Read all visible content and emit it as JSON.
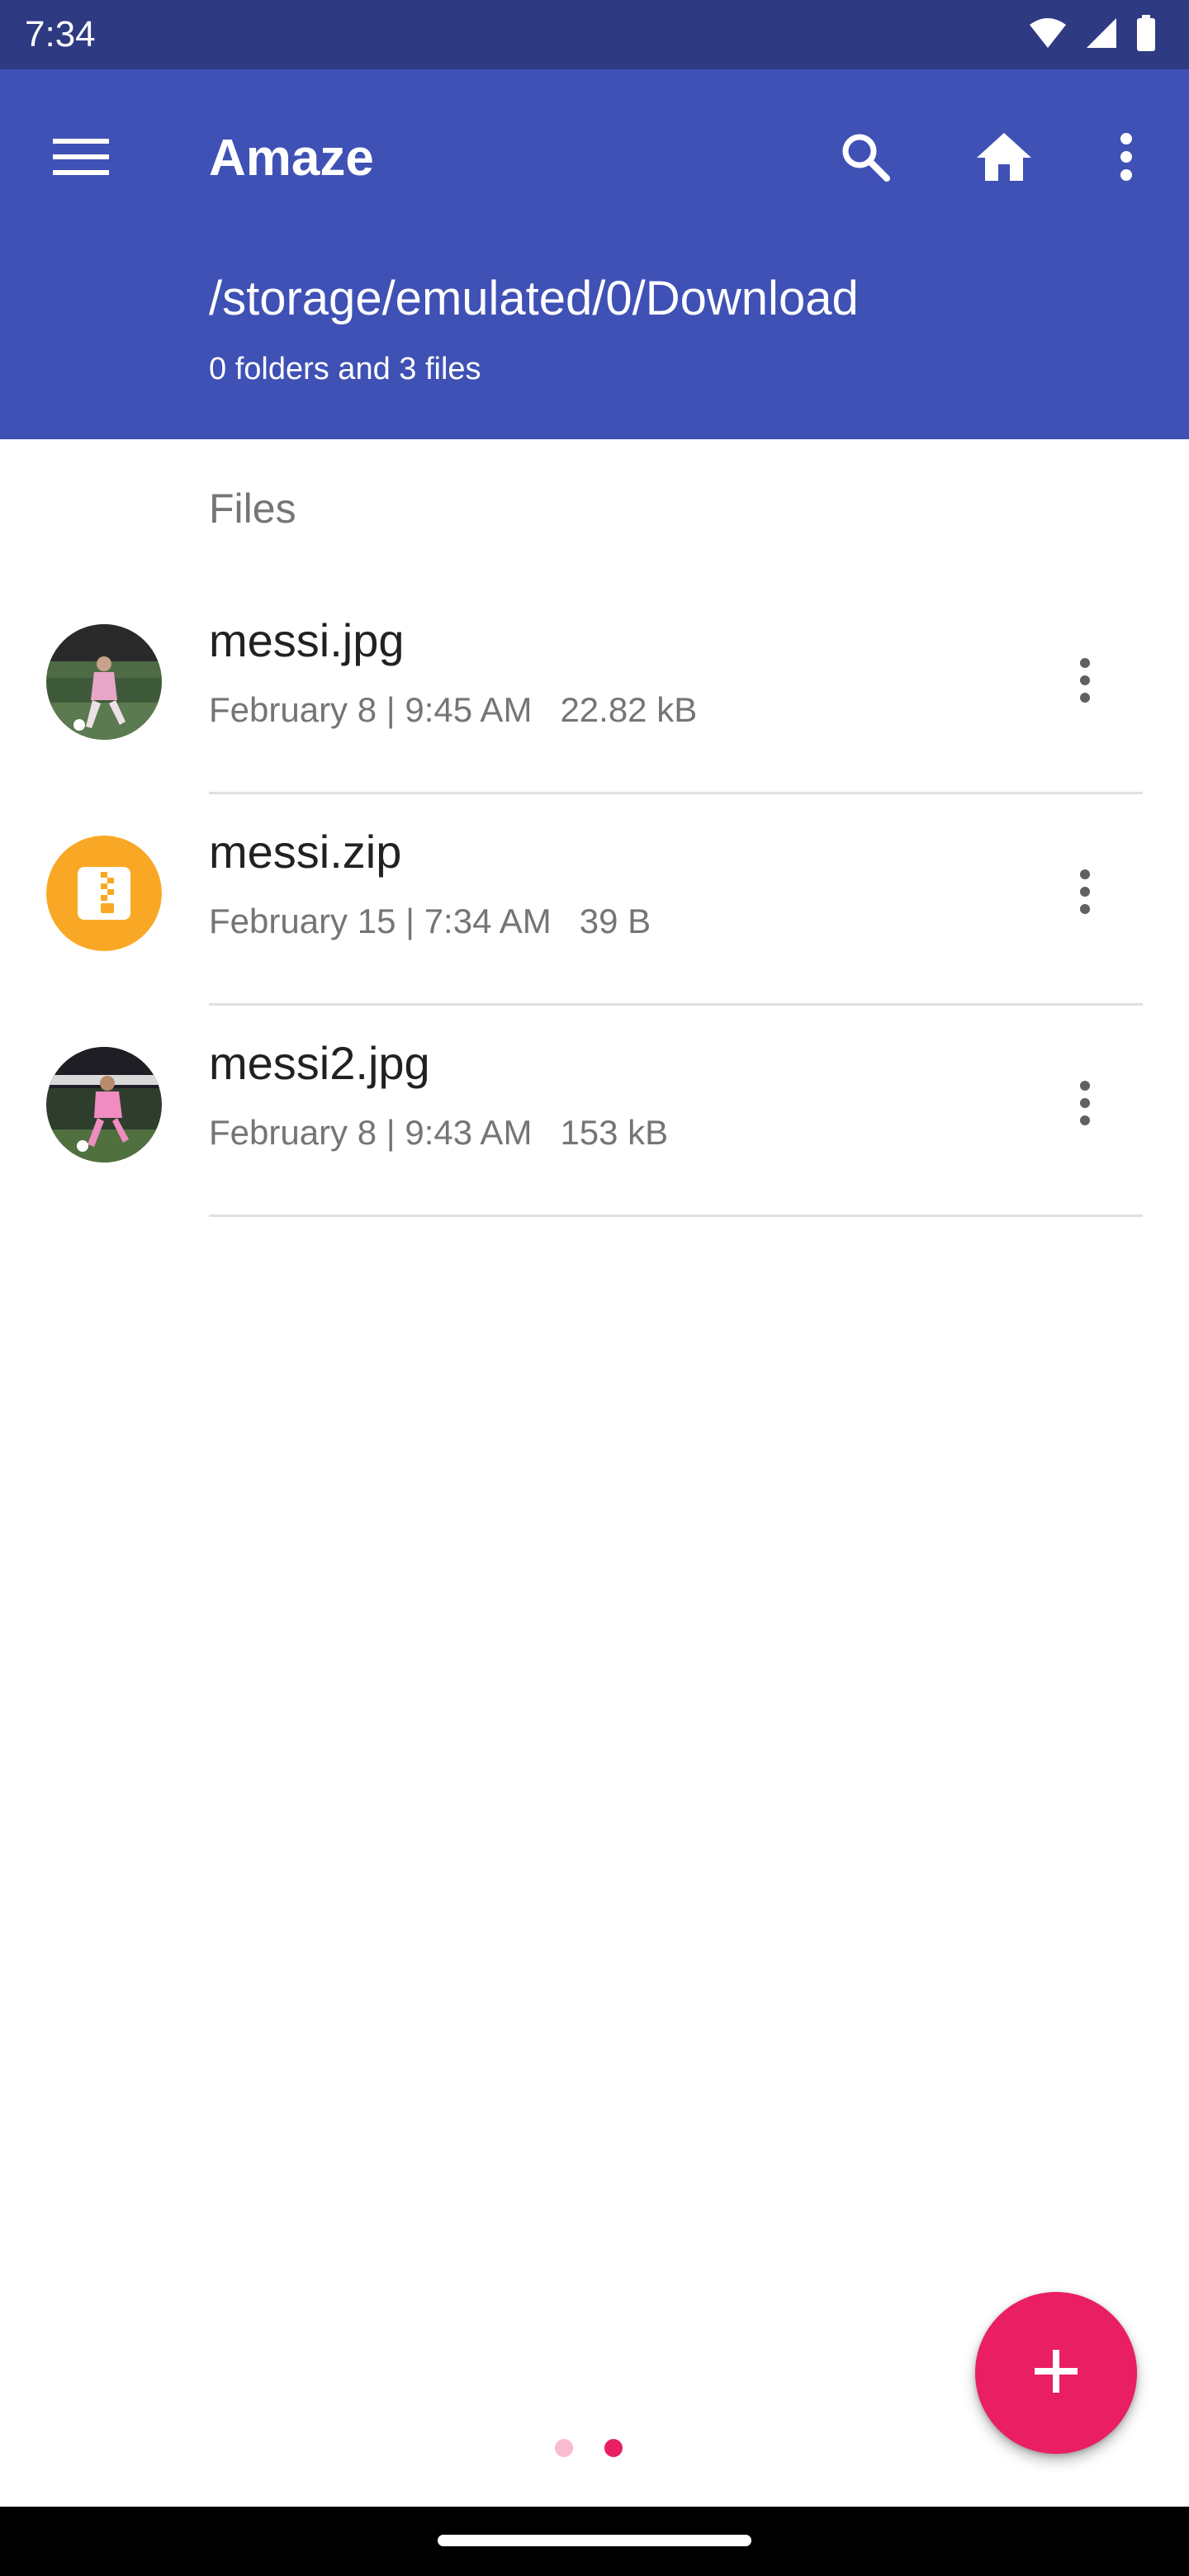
{
  "status_bar": {
    "time": "7:34",
    "icons": [
      "wifi-icon",
      "signal-icon",
      "battery-icon"
    ]
  },
  "app_bar": {
    "title": "Amaze",
    "path": "/storage/emulated/0/Download",
    "summary": "0 folders and 3 files",
    "icons": [
      "menu-icon",
      "search-icon",
      "home-icon",
      "more-vert-icon"
    ]
  },
  "list": {
    "section_header": "Files",
    "files": [
      {
        "name": "messi.jpg",
        "date": "February 8 | 9:45 AM",
        "size": "22.82 kB",
        "thumb": "image-thumbnail"
      },
      {
        "name": "messi.zip",
        "date": "February 15 | 7:34 AM",
        "size": "39 B",
        "thumb": "zip-icon"
      },
      {
        "name": "messi2.jpg",
        "date": "February 8 | 9:43 AM",
        "size": "153 kB",
        "thumb": "image-thumbnail"
      }
    ]
  },
  "fab": {
    "icon": "plus-icon"
  },
  "pager": {
    "count": 2,
    "active_index": 1
  },
  "colors": {
    "status_bar": "#2E3A82",
    "primary": "#3F51B5",
    "accent": "#E91E63",
    "zip_icon": "#F9A825",
    "secondary_text": "#757575",
    "divider": "#E0E0E0"
  }
}
